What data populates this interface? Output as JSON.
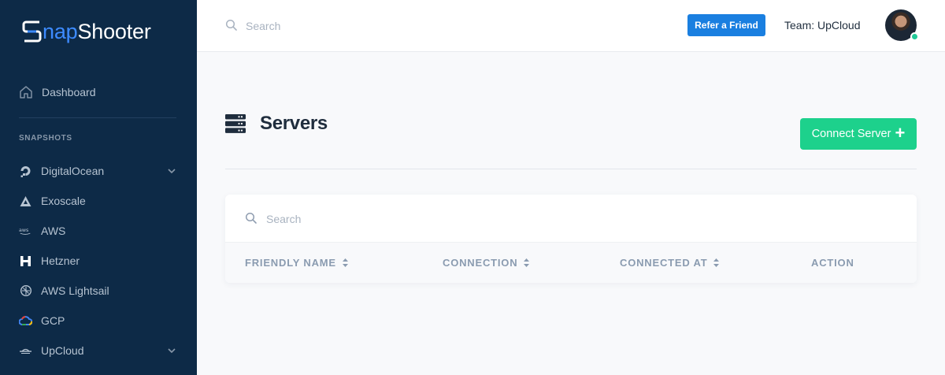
{
  "app": {
    "logo_mark": "S",
    "logo_accent": "nap",
    "logo_rest": "Shooter"
  },
  "sidebar": {
    "dashboard_label": "Dashboard",
    "section_label": "SNAPSHOTS",
    "items": [
      {
        "label": "DigitalOcean",
        "icon": "digitalocean-icon",
        "expandable": true
      },
      {
        "label": "Exoscale",
        "icon": "exoscale-icon",
        "expandable": false
      },
      {
        "label": "AWS",
        "icon": "aws-icon",
        "expandable": false
      },
      {
        "label": "Hetzner",
        "icon": "hetzner-icon",
        "expandable": false
      },
      {
        "label": "AWS Lightsail",
        "icon": "lightsail-icon",
        "expandable": false
      },
      {
        "label": "GCP",
        "icon": "gcp-icon",
        "expandable": false
      },
      {
        "label": "UpCloud",
        "icon": "upcloud-icon",
        "expandable": true
      }
    ]
  },
  "topbar": {
    "search_placeholder": "Search",
    "refer_label": "Refer a Friend",
    "team_label": "Team: UpCloud"
  },
  "main": {
    "title": "Servers",
    "connect_label": "Connect Server",
    "table": {
      "search_placeholder": "Search",
      "columns": [
        "FRIENDLY NAME",
        "CONNECTION",
        "CONNECTED AT",
        "ACTION"
      ]
    }
  },
  "colors": {
    "sidebar_bg": "#0d2a47",
    "logo_accent": "#3d8bff",
    "refer_button": "#1a7fe0",
    "connect_button": "#1dd18c",
    "online_status": "#20c997"
  }
}
